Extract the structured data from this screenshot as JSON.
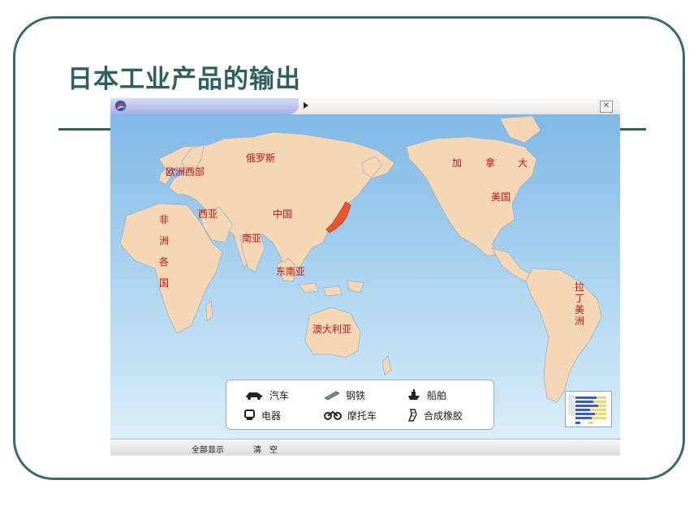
{
  "slide": {
    "title": "日本工业产品的输出"
  },
  "map": {
    "regions": {
      "europe_west": "欧洲西部",
      "russia": "俄罗斯",
      "canada": [
        "加",
        "拿",
        "大"
      ],
      "usa": "美国",
      "west_asia": "西亚",
      "china": "中国",
      "south_asia": "南亚",
      "southeast_asia": "东南亚",
      "africa": [
        "非",
        "洲",
        "各",
        "国"
      ],
      "latin_america": [
        "拉",
        "丁",
        "美",
        "洲"
      ],
      "australia": "澳大利亚"
    }
  },
  "legend": {
    "items": [
      {
        "icon": "car-icon",
        "label": "汽车"
      },
      {
        "icon": "steel-icon",
        "label": "钢铁"
      },
      {
        "icon": "ship-icon",
        "label": "船舶"
      },
      {
        "icon": "appliance-icon",
        "label": "电器"
      },
      {
        "icon": "motorcycle-icon",
        "label": "摩托车"
      },
      {
        "icon": "rubber-icon",
        "label": "合成橡胶"
      }
    ]
  },
  "toolbar": {
    "show_all": "全部显示",
    "clear": "清　空"
  },
  "colors": {
    "land": "#f6d7b5",
    "ocean": "#c9e4f3",
    "japan": "#e8562a",
    "label": "#c8100e",
    "frame": "#3a6b6b"
  }
}
